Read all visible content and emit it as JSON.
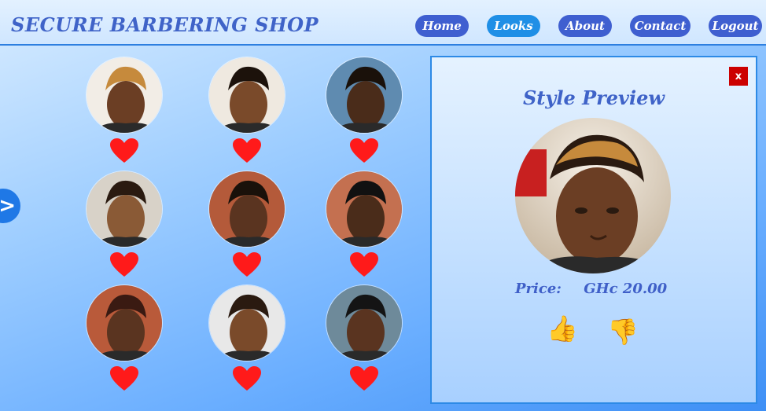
{
  "brand": "SECURE BARBERING SHOP",
  "nav": {
    "items": [
      {
        "label": "Home",
        "active": false
      },
      {
        "label": "Looks",
        "active": true
      },
      {
        "label": "About",
        "active": false
      },
      {
        "label": "Contact",
        "active": false
      },
      {
        "label": "Logout",
        "active": false
      }
    ]
  },
  "side_toggle": {
    "glyph": ">"
  },
  "gallery": {
    "items": [
      {
        "name": "style-1"
      },
      {
        "name": "style-2"
      },
      {
        "name": "style-3"
      },
      {
        "name": "style-4"
      },
      {
        "name": "style-5"
      },
      {
        "name": "style-6"
      },
      {
        "name": "style-7"
      },
      {
        "name": "style-8"
      },
      {
        "name": "style-9"
      }
    ]
  },
  "preview": {
    "title": "Style Preview",
    "close_label": "x",
    "price_label": "Price:",
    "price_value": "GHc 20.00",
    "like_glyph": "👍",
    "dislike_glyph": "👎"
  },
  "colors": {
    "brand": "#3f63c8",
    "nav_button": "#3f5fd0",
    "nav_active": "#1f8fe6",
    "heart": "#ff1a1a",
    "close": "#cc0000",
    "border": "#2d8ae6"
  }
}
